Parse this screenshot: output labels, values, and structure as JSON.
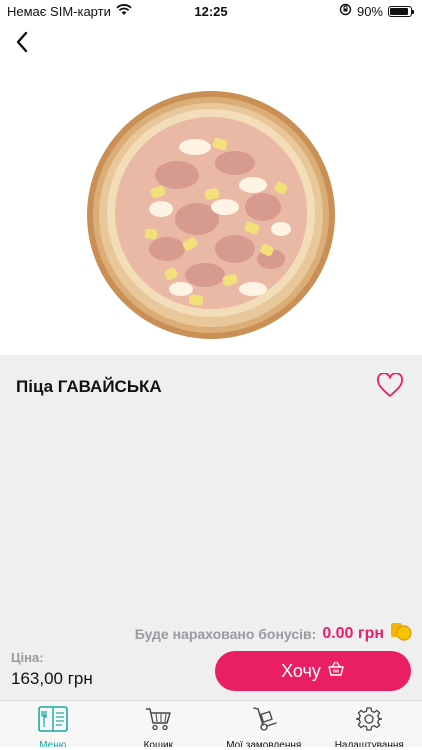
{
  "status_bar": {
    "carrier": "Немає SIM-карти",
    "time": "12:25",
    "battery": "90%",
    "battery_level": 0.9
  },
  "nav": {
    "back_icon": "chevron-left-icon"
  },
  "product": {
    "title": "Піца ГАВАЙСЬКА",
    "image": "pizza-hawaiian",
    "favorite_icon": "heart-outline-icon"
  },
  "bonus": {
    "label": "Буде нараховано бонусів:",
    "value": "0.00 грн",
    "icon": "coins-icon"
  },
  "price": {
    "label": "Ціна:",
    "value": "163,00 грн"
  },
  "cta": {
    "label": "Хочу",
    "icon": "basket-icon"
  },
  "tabs": [
    {
      "label": "Меню",
      "icon": "menu-book-icon",
      "active": true
    },
    {
      "label": "Кошик",
      "icon": "cart-icon",
      "active": false
    },
    {
      "label": "Мої замовлення",
      "icon": "hand-truck-icon",
      "active": false
    },
    {
      "label": "Налаштування",
      "icon": "gear-icon",
      "active": false
    }
  ],
  "colors": {
    "accent": "#e91e63",
    "active_tab": "#1aa7a0",
    "muted_text": "#9a9a9f",
    "coin": "#f5b400"
  }
}
